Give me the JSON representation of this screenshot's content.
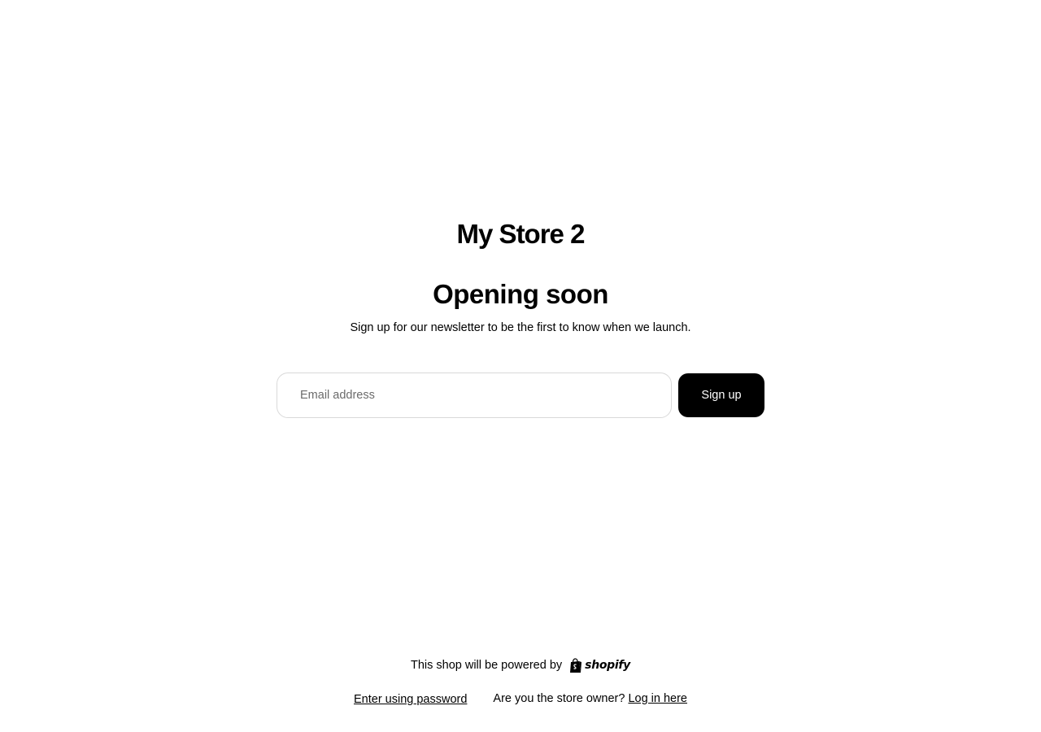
{
  "store": {
    "name": "My Store 2"
  },
  "main": {
    "headline": "Opening soon",
    "subtext": "Sign up for our newsletter to be the first to know when we launch."
  },
  "signup": {
    "email_placeholder": "Email address",
    "email_value": "",
    "button_label": "Sign up"
  },
  "footer": {
    "powered_by": "This shop will be powered by",
    "shopify_wordmark": "shopify",
    "enter_password": "Enter using password",
    "owner_question": "Are you the store owner?",
    "login_link": "Log in here"
  },
  "icons": {
    "shopify_logo": "shopify-bag-icon"
  },
  "colors": {
    "button_bg": "#000000",
    "button_text": "#ffffff",
    "input_border": "#d9d9d9"
  }
}
